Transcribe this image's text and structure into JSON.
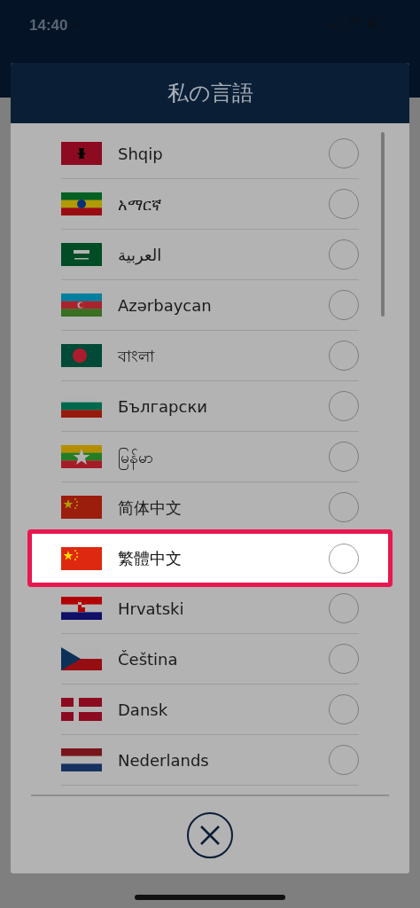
{
  "status_bar": {
    "time": "14:40"
  },
  "dialog": {
    "title": "私の言語",
    "languages": [
      {
        "name": "Shqip",
        "kind": "albania",
        "selected": false,
        "highlighted": false
      },
      {
        "name": "አማርኛ",
        "kind": "ethiopia",
        "selected": false,
        "highlighted": false
      },
      {
        "name": "العربية",
        "kind": "saudi",
        "selected": false,
        "highlighted": false
      },
      {
        "name": "Azərbaycan",
        "kind": "azerbaijan",
        "selected": false,
        "highlighted": false
      },
      {
        "name": "বাংলা",
        "kind": "bangladesh",
        "selected": false,
        "highlighted": false
      },
      {
        "name": "Български",
        "kind": "bulgaria",
        "selected": false,
        "highlighted": false
      },
      {
        "name": "မြန်မာ",
        "kind": "myanmar",
        "selected": false,
        "highlighted": false
      },
      {
        "name": "简体中文",
        "kind": "china",
        "selected": false,
        "highlighted": false
      },
      {
        "name": "繁體中文",
        "kind": "china",
        "selected": false,
        "highlighted": true
      },
      {
        "name": "Hrvatski",
        "kind": "croatia",
        "selected": false,
        "highlighted": false
      },
      {
        "name": "Čeština",
        "kind": "czechia",
        "selected": false,
        "highlighted": false
      },
      {
        "name": "Dansk",
        "kind": "denmark",
        "selected": false,
        "highlighted": false
      },
      {
        "name": "Nederlands",
        "kind": "netherlands",
        "selected": false,
        "highlighted": false
      }
    ]
  }
}
